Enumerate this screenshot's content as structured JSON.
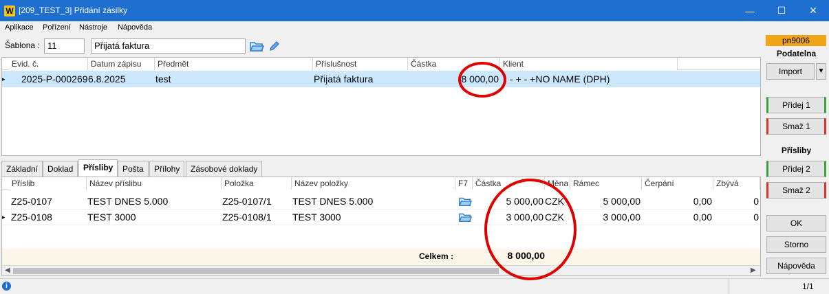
{
  "window": {
    "app_logo": "W",
    "title": "[209_TEST_3] Přidání zásilky",
    "minimize_glyph": "—",
    "maximize_glyph": "☐",
    "close_glyph": "✕"
  },
  "menu": [
    "Aplikace",
    "Pořízení",
    "Nástroje",
    "Nápověda"
  ],
  "template": {
    "label": "Šablona :",
    "code": "11",
    "name": "Přijatá faktura"
  },
  "main_grid": {
    "columns": [
      "Evid. č.",
      "Datum zápisu",
      "Předmět",
      "Příslušnost",
      "Částka",
      "Klient"
    ],
    "rows": [
      {
        "evid": "2025-P-000269",
        "date": "6.8.2025",
        "subject": "test",
        "affiliation": "Přijatá faktura",
        "amount": "8 000,00",
        "client": "- + - +NO NAME (DPH)"
      }
    ]
  },
  "tabs": [
    "Základní",
    "Doklad",
    "Přísliby",
    "Pošta",
    "Přílohy",
    "Zásobové doklady"
  ],
  "active_tab": "Přísliby",
  "commit_grid": {
    "columns": [
      "Příslib",
      "Název příslibu",
      "Položka",
      "Název položky",
      "F7",
      "Částka",
      "Měna",
      "Rámec",
      "Čerpání",
      "Zbývá"
    ],
    "rows": [
      {
        "commit": "Z25-0107",
        "commit_name": "TEST DNES 5.000",
        "item": "Z25-0107/1",
        "item_name": "TEST DNES 5.000",
        "amount": "5 000,00",
        "currency": "CZK",
        "frame": "5 000,00",
        "drawn": "0,00",
        "remaining": "0"
      },
      {
        "commit": "Z25-0108",
        "commit_name": "TEST 3000",
        "item": "Z25-0108/1",
        "item_name": "TEST 3000",
        "amount": "3 000,00",
        "currency": "CZK",
        "frame": "3 000,00",
        "drawn": "0,00",
        "remaining": "0"
      }
    ],
    "total_label": "Celkem :",
    "total_value": "8 000,00"
  },
  "right_panel": {
    "user_badge": "pn9006",
    "filing_header": "Podatelna",
    "import_label": "Import",
    "import_arrow": "▼",
    "add1": "Přidej 1",
    "del1": "Smaž 1",
    "commit_header": "Přísliby",
    "add2": "Přidej 2",
    "del2": "Smaž 2",
    "ok": "OK",
    "cancel": "Storno",
    "help": "Nápověda"
  },
  "status": {
    "info_glyph": "i",
    "page": "1/1"
  },
  "colors": {
    "titlebar": "#1f6fd1",
    "selected_row": "#cce8ff",
    "badge": "#f2a516",
    "annotation": "#e00000",
    "add_accent": "#3aa63a",
    "delete_accent": "#d9332b"
  }
}
